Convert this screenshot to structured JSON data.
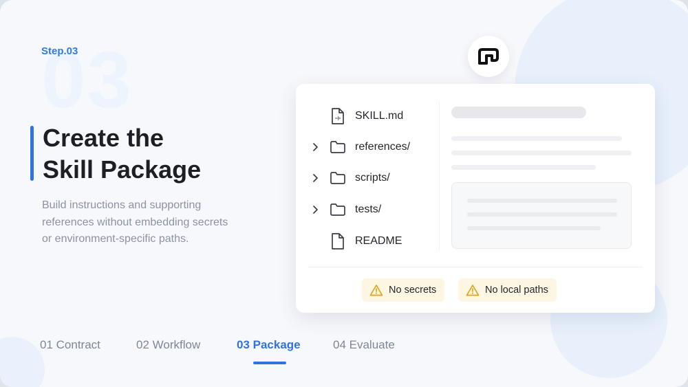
{
  "step": {
    "label": "Step.03",
    "big_number": "03"
  },
  "title": {
    "line1": "Create the",
    "line2": "Skill Package"
  },
  "description": "Build instructions and supporting references without embedding secrets or environment-specific paths.",
  "file_tree": {
    "items": [
      {
        "label": "SKILL.md",
        "icon": "markdown-file-icon",
        "expandable": false
      },
      {
        "label": "references/",
        "icon": "folder-icon",
        "expandable": true
      },
      {
        "label": "scripts/",
        "icon": "folder-icon",
        "expandable": true
      },
      {
        "label": "tests/",
        "icon": "folder-icon",
        "expandable": true
      },
      {
        "label": "README",
        "icon": "file-icon",
        "expandable": false
      }
    ]
  },
  "badges": [
    {
      "label": "No secrets",
      "icon": "warning-icon"
    },
    {
      "label": "No local paths",
      "icon": "warning-icon"
    }
  ],
  "tabs": [
    {
      "label": "01 Contract",
      "active": false
    },
    {
      "label": "02 Workflow",
      "active": false
    },
    {
      "label": "03 Package",
      "active": true
    },
    {
      "label": "04 Evaluate",
      "active": false
    }
  ],
  "colors": {
    "accent": "#2f73e0",
    "warning": "#e0a317",
    "badge_bg": "#fdf6e3",
    "text_dark": "#1c1f26",
    "text_muted": "#8a93a3"
  }
}
